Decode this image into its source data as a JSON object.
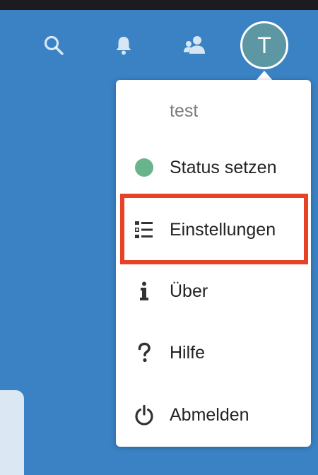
{
  "header": {
    "icons": [
      "search-icon",
      "bell-icon",
      "contacts-icon"
    ],
    "avatar_letter": "T"
  },
  "menu": {
    "user_name": "test",
    "items": [
      {
        "label": "Status setzen",
        "icon": "status-dot-icon"
      },
      {
        "label": "Einstellungen",
        "icon": "settings-list-icon",
        "highlighted": true
      },
      {
        "label": "Über",
        "icon": "info-icon"
      },
      {
        "label": "Hilfe",
        "icon": "help-icon"
      },
      {
        "label": "Abmelden",
        "icon": "power-icon"
      }
    ]
  },
  "colors": {
    "background": "#3a82c4",
    "avatar": "#5d97a3",
    "status_online": "#6ab48c",
    "highlight": "#e84226"
  }
}
